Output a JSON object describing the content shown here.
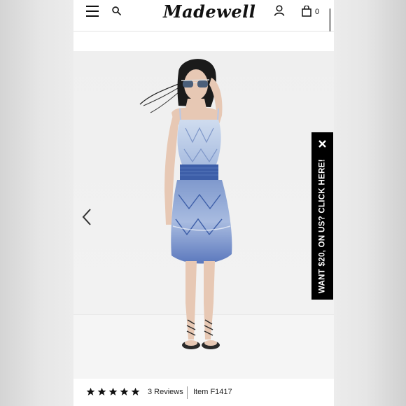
{
  "header": {
    "logo_text": "Madewell",
    "bag_count": "0"
  },
  "product": {
    "image_description_name": "model-photo",
    "promo_text": "WANT $20, ON US? CLICK HERE!",
    "rating_stars": 5,
    "review_count": "3 Reviews",
    "item_number": "Item F1417"
  },
  "icons": {
    "menu": "hamburger-icon",
    "search": "search-icon",
    "account": "user-icon",
    "bag": "shopping-bag-icon",
    "prev": "chevron-left-icon",
    "close": "close-icon",
    "star": "star-icon"
  },
  "colors": {
    "brand": "#111111",
    "promo_bg": "#000000",
    "dress_blue": "#4d6fb5"
  }
}
